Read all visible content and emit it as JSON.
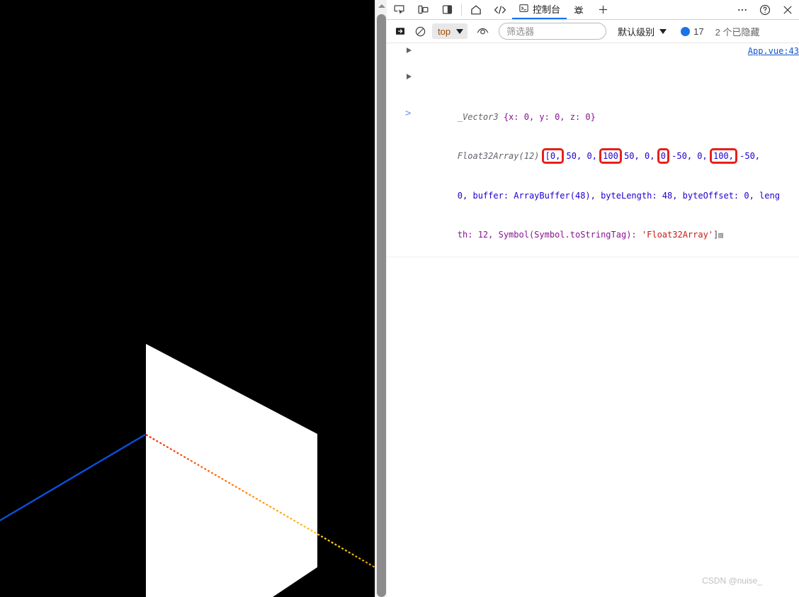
{
  "window": {
    "watermark": "CSDN @nuise_"
  },
  "devtools": {
    "tabs_left": [
      {
        "name": "inspect-element",
        "icon": "cursor-box-icon",
        "label": ""
      },
      {
        "name": "device-toolbar",
        "icon": "devices-icon",
        "label": ""
      },
      {
        "name": "panel-layout",
        "icon": "panel-icon",
        "label": ""
      }
    ],
    "tabs_main": [
      {
        "name": "home",
        "icon": "home-icon",
        "label": ""
      },
      {
        "name": "elements",
        "icon": "code-icon",
        "label": ""
      },
      {
        "name": "console",
        "icon": "terminal-icon",
        "label": "控制台",
        "active": true
      },
      {
        "name": "issues",
        "icon": "bug-icon",
        "label": ""
      },
      {
        "name": "more-panels",
        "icon": "plus-icon",
        "label": ""
      }
    ],
    "tabs_right": [
      {
        "name": "more-options",
        "icon": "ellipsis-icon",
        "label": ""
      },
      {
        "name": "help",
        "icon": "question-circle-icon",
        "label": ""
      },
      {
        "name": "close-devtools",
        "icon": "close-icon",
        "label": ""
      }
    ],
    "toolbar": {
      "sidebar_toggle_icon": "sidebar-toggle-icon",
      "clear_console_icon": "clear-console-icon",
      "context_value": "top",
      "live_expression_icon": "eye-icon",
      "filter_placeholder": "筛选器",
      "filter_value": "",
      "level_label": "默认级别",
      "issues_count": "17",
      "hidden_label": "2 个已隐藏"
    },
    "console": {
      "source_link": "App.vue:43",
      "line1_class": "_Vector3",
      "line1_body": " {x: 0, y: 0, z: 0}",
      "array_label": "Float32Array(12)",
      "array_open": "[0,",
      "array_values": [
        "50,",
        "0,",
        "100",
        "50,",
        "0,",
        "0",
        "-50,",
        "0,",
        "100,",
        "-50,"
      ],
      "array_highlights": [
        true,
        false,
        false,
        true,
        false,
        false,
        true,
        false,
        false,
        true,
        false
      ],
      "line3": "0, buffer: ArrayBuffer(48), byteLength: 48, byteOffset: 0, leng",
      "line4_prop": "th: 12, Symbol(Symbol.toStringTag): ",
      "line4_str": "'Float32Array'",
      "line4_end": "]",
      "prompt_chevron": ">",
      "values_detail": {
        "buffer": "ArrayBuffer(48)",
        "byteLength": "48",
        "byteOffset": "0",
        "length": "12",
        "toStringTag": "'Float32Array'",
        "vector3": {
          "x": "0",
          "y": "0",
          "z": "0"
        },
        "float32array_12": [
          "0",
          "50",
          "0",
          "100",
          "50",
          "0",
          "0",
          "-50",
          "0",
          "100",
          "-50",
          "0"
        ]
      }
    }
  },
  "viewport": {
    "background": "#000000",
    "plane_color": "#ffffff",
    "axes": [
      {
        "name": "y-axis-positive",
        "color": "#44dd00",
        "label": ""
      },
      {
        "name": "z-axis-negative",
        "color": "#0b14e8",
        "label": ""
      },
      {
        "name": "x-axis-positive",
        "color": "#ff3b10",
        "label": ""
      }
    ]
  },
  "scrollbar": {
    "name": "page-vertical-scrollbar",
    "thumb_color": "#8c8c8c",
    "track_color": "#f1f1f1"
  }
}
